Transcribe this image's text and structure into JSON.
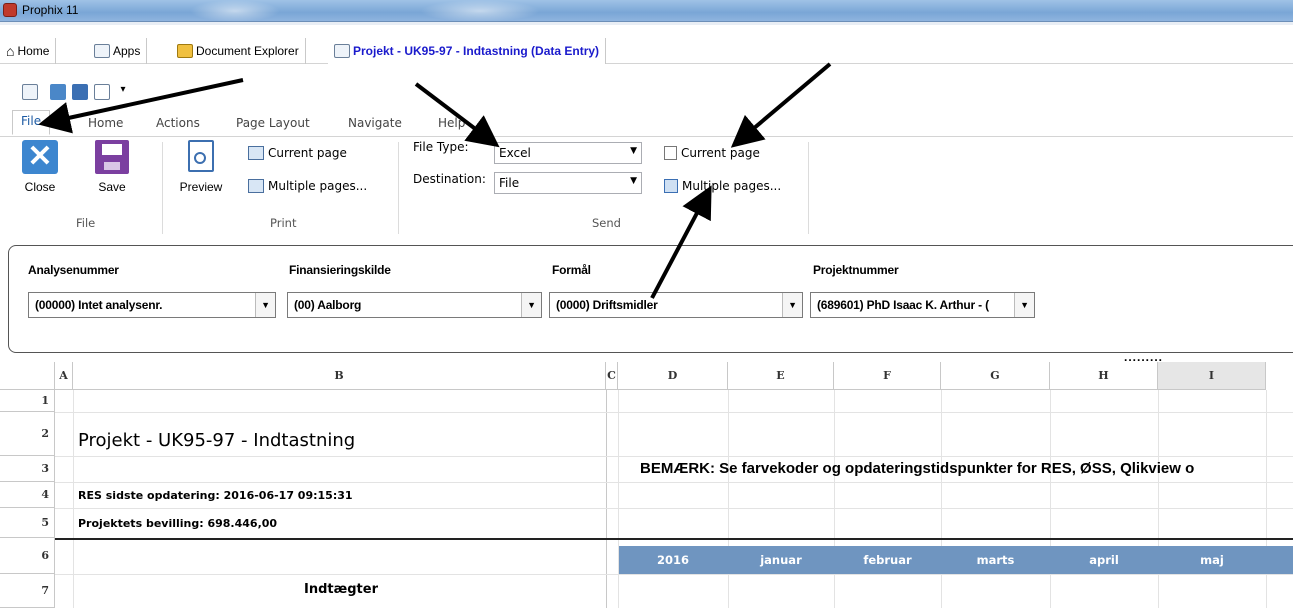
{
  "app": {
    "title": "Prophix 11"
  },
  "doc_tabs": [
    {
      "label": "Home"
    },
    {
      "label": "Apps"
    },
    {
      "label": "Document Explorer"
    },
    {
      "label": "Projekt - UK95-97 - Indtastning (Data Entry)"
    }
  ],
  "ribbon_tabs": [
    "File",
    "Home",
    "Actions",
    "Page Layout",
    "Navigate",
    "Help"
  ],
  "ribbon": {
    "file_group": {
      "close": "Close",
      "save": "Save",
      "label": "File"
    },
    "print_group": {
      "preview": "Preview",
      "current": "Current page",
      "multiple": "Multiple pages...",
      "label": "Print"
    },
    "send_group": {
      "file_type_label": "File Type:",
      "file_type_value": "Excel",
      "destination_label": "Destination:",
      "destination_value": "File",
      "current": "Current page",
      "multiple": "Multiple pages...",
      "label": "Send"
    }
  },
  "filters": [
    {
      "label": "Analysenummer",
      "value": "(00000) Intet analysenr."
    },
    {
      "label": "Finansieringskilde",
      "value": "(00) Aalborg"
    },
    {
      "label": "Formål",
      "value": "(0000) Driftsmidler"
    },
    {
      "label": "Projektnummer",
      "value": "(689601) PhD Isaac K. Arthur - ("
    }
  ],
  "dots": ".........",
  "sheet": {
    "columns": [
      "A",
      "B",
      "C",
      "D",
      "E",
      "F",
      "G",
      "H",
      "I"
    ],
    "rows": [
      "1",
      "2",
      "3",
      "4",
      "5",
      "6",
      "7"
    ],
    "cells": {
      "b2": "Projekt - UK95-97 - Indtastning",
      "d3": "BEMÆRK: Se farvekoder og opdateringstidspunkter for RES, ØSS, Qlikview o",
      "b4_bold": "RES",
      "b4_rest": " sidste opdatering: 2016-06-17 09:15:31",
      "b5": "Projektets bevilling: 698.446,00",
      "b7": "Indtægter"
    },
    "header_row": [
      "2016",
      "januar",
      "februar",
      "marts",
      "april",
      "maj"
    ],
    "header_color": "#6f95c0"
  }
}
